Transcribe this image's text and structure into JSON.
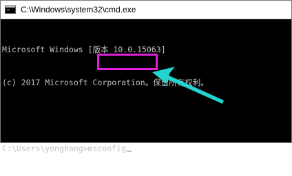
{
  "window": {
    "title": "C:\\Windows\\system32\\cmd.exe"
  },
  "console": {
    "line1": "Microsoft Windows [版本 10.0.15063]",
    "line2": "(c) 2017 Microsoft Corporation。保留所有权利。",
    "prompt": "C:\\Users\\yonghang>",
    "command": "msconfig"
  },
  "annotation": {
    "highlight_color": "#e020d8",
    "arrow_color": "#22d3d0"
  }
}
